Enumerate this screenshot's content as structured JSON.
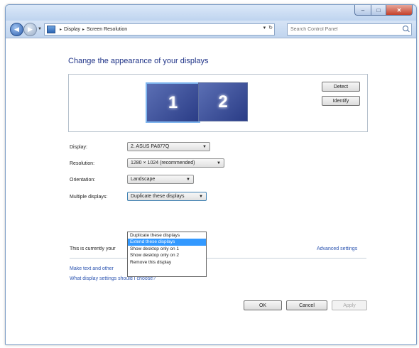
{
  "window": {
    "address": {
      "crumbs": [
        "Display",
        "Screen Resolution"
      ],
      "refresh_glyph": "↻"
    },
    "search": {
      "placeholder": "Search Control Panel"
    },
    "caption": {
      "minimize": "–",
      "maximize": "□",
      "close": "✕"
    }
  },
  "page": {
    "heading": "Change the appearance of your displays",
    "preview": {
      "monitors": [
        {
          "label": "1"
        },
        {
          "label": "2"
        }
      ],
      "detect_label": "Detect",
      "identify_label": "Identify"
    },
    "settings": {
      "display_label": "Display:",
      "display_value": "2. ASUS PA877Q",
      "resolution_label": "Resolution:",
      "resolution_value": "1280 × 1024 (recommended)",
      "orientation_label": "Orientation:",
      "orientation_value": "Landscape",
      "multiple_label": "Multiple displays:",
      "multiple_value": "Duplicate these displays",
      "multiple_options": [
        "Duplicate these displays",
        "Extend these displays",
        "Show desktop only on 1",
        "Show desktop only on 2",
        "Remove this display"
      ]
    },
    "info_text": "This is currently your",
    "advanced_link": "Advanced settings",
    "link_text_size": "Make text and other",
    "link_which_settings": "What display settings should I choose?",
    "buttons": {
      "ok": "OK",
      "cancel": "Cancel",
      "apply": "Apply"
    }
  },
  "colors": {
    "accent": "#3399ff",
    "link": "#2a53b0",
    "heading": "#1e3287"
  }
}
